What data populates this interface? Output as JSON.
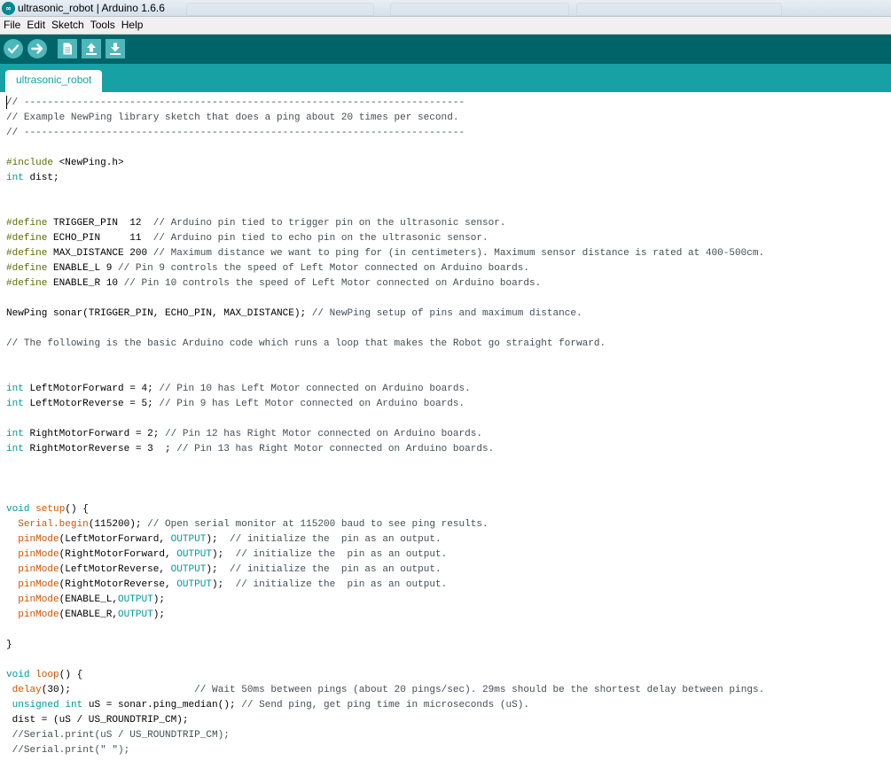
{
  "window": {
    "title": "ultrasonic_robot | Arduino 1.6.6",
    "logo_text": "∞"
  },
  "menu": [
    "File",
    "Edit",
    "Sketch",
    "Tools",
    "Help"
  ],
  "toolbar": {
    "accent": "#006468",
    "button_color": "#4db7bb",
    "buttons": [
      "verify",
      "upload",
      "new",
      "open",
      "save"
    ]
  },
  "tabs": [
    {
      "label": "ultrasonic_robot",
      "active": true
    }
  ],
  "colors": {
    "comment": "#434f54",
    "keyword": "#00979c",
    "directive": "#5e6d03",
    "function": "#d35400",
    "tab_bar": "#17a1a5"
  },
  "code_lines": [
    "// ---------------------------------------------------------------------------",
    "// Example NewPing library sketch that does a ping about 20 times per second.",
    "// ---------------------------------------------------------------------------",
    "",
    "#include <NewPing.h>",
    "int dist;",
    "",
    "",
    "#define TRIGGER_PIN  12  // Arduino pin tied to trigger pin on the ultrasonic sensor.",
    "#define ECHO_PIN     11  // Arduino pin tied to echo pin on the ultrasonic sensor.",
    "#define MAX_DISTANCE 200 // Maximum distance we want to ping for (in centimeters). Maximum sensor distance is rated at 400-500cm.",
    "#define ENABLE_L 9 // Pin 9 controls the speed of Left Motor connected on Arduino boards.",
    "#define ENABLE_R 10 // Pin 10 controls the speed of Left Motor connected on Arduino boards.",
    "",
    "NewPing sonar(TRIGGER_PIN, ECHO_PIN, MAX_DISTANCE); // NewPing setup of pins and maximum distance.",
    "",
    "// The following is the basic Arduino code which runs a loop that makes the Robot go straight forward.",
    "",
    "",
    "int LeftMotorForward = 4; // Pin 10 has Left Motor connected on Arduino boards.",
    "int LeftMotorReverse = 5; // Pin 9 has Left Motor connected on Arduino boards.",
    "",
    "int RightMotorForward = 2; // Pin 12 has Right Motor connected on Arduino boards.",
    "int RightMotorReverse = 3  ; // Pin 13 has Right Motor connected on Arduino boards.",
    "",
    "",
    "",
    "void setup() {",
    "  Serial.begin(115200); // Open serial monitor at 115200 baud to see ping results.",
    "  pinMode(LeftMotorForward, OUTPUT);  // initialize the  pin as an output.",
    "  pinMode(RightMotorForward, OUTPUT);  // initialize the  pin as an output.",
    "  pinMode(LeftMotorReverse, OUTPUT);  // initialize the  pin as an output.",
    "  pinMode(RightMotorReverse, OUTPUT);  // initialize the  pin as an output.",
    "  pinMode(ENABLE_L,OUTPUT);",
    "  pinMode(ENABLE_R,OUTPUT);",
    "",
    "}",
    "",
    "void loop() {",
    " delay(30);                     // Wait 50ms between pings (about 20 pings/sec). 29ms should be the shortest delay between pings.",
    " unsigned int uS = sonar.ping_median(); // Send ping, get ping time in microseconds (uS).",
    " dist = (uS / US_ROUNDTRIP_CM);",
    " //Serial.print(uS / US_ROUNDTRIP_CM);",
    " //Serial.print(\" \");"
  ]
}
